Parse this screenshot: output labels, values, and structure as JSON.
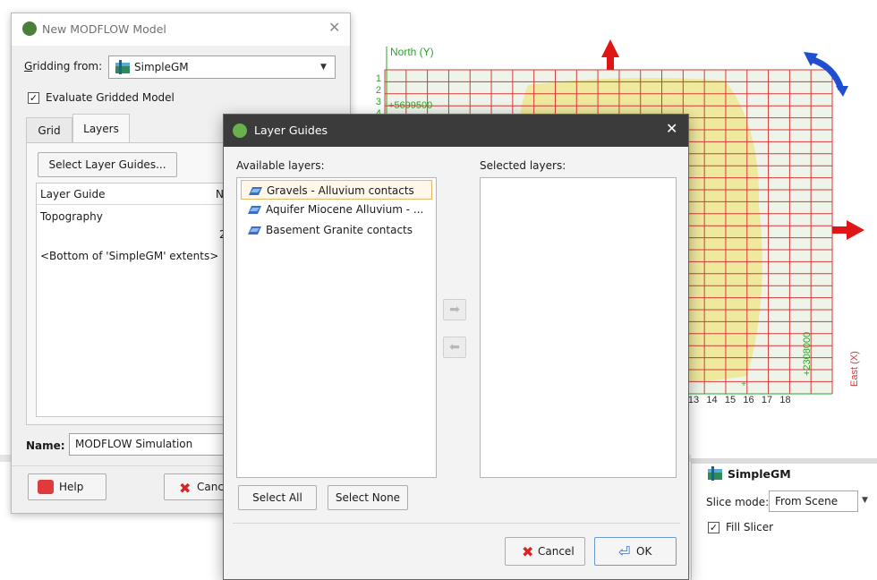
{
  "modflow_window": {
    "title": "New MODFLOW Model",
    "close": "✕",
    "gridding_from_label": "Gridding from:",
    "gridding_from_value": "SimpleGM",
    "dropdown_arrow": "▼",
    "evaluate_label": "Evaluate Gridded Model",
    "evaluate_checked": "✓",
    "tabs": [
      {
        "label": "Grid"
      },
      {
        "label": "Layers"
      }
    ],
    "select_layer_guides": "Select Layer Guides...",
    "table": {
      "columns": [
        "Layer Guide",
        "N"
      ],
      "rows": [
        "Topography",
        "<Bottom of 'SimpleGM' extents>"
      ],
      "extra_value": "2"
    },
    "name_label": "Name:",
    "name_value": "MODFLOW Simulation",
    "help_label": "Help",
    "cancel_label": "Canc"
  },
  "layer_guides": {
    "title": "Layer Guides",
    "close": "✕",
    "available_label": "Available layers:",
    "selected_label": "Selected layers:",
    "available_items": [
      {
        "label": "Gravels - Alluvium contacts"
      },
      {
        "label": "Aquifer Miocene Alluvium - ..."
      },
      {
        "label": "Basement Granite contacts"
      }
    ],
    "add_arrow": "➡",
    "remove_arrow": "⬅",
    "select_all": "Select All",
    "select_none": "Select None",
    "cancel": "Cancel",
    "ok": "OK"
  },
  "scene": {
    "north_label": "North (Y)",
    "east_label": "East (X)",
    "y_numbers": [
      "1",
      "2",
      "3",
      "4"
    ],
    "y_coord": "+5699500",
    "x_coord": "+2308000",
    "x_numbers": [
      "13",
      "14",
      "15",
      "16",
      "17",
      "18"
    ],
    "x_tick_mark": "+"
  },
  "props_panel": {
    "title": "SimpleGM",
    "slice_mode_label": "Slice mode:",
    "slice_mode_value": "From Scene",
    "dropdown_arrow": "▼",
    "fill_slicer_label": "Fill Slicer",
    "fill_slicer_checked": "✓"
  },
  "colors": {
    "grid_line": "#d63a3a",
    "grid_bg": "#e8f2e2",
    "accent_arrow": "#e01515",
    "rotate_arrow": "#1f4fd0",
    "axis_green": "#2aa52a",
    "dialog_title": "#3b3b3b"
  }
}
